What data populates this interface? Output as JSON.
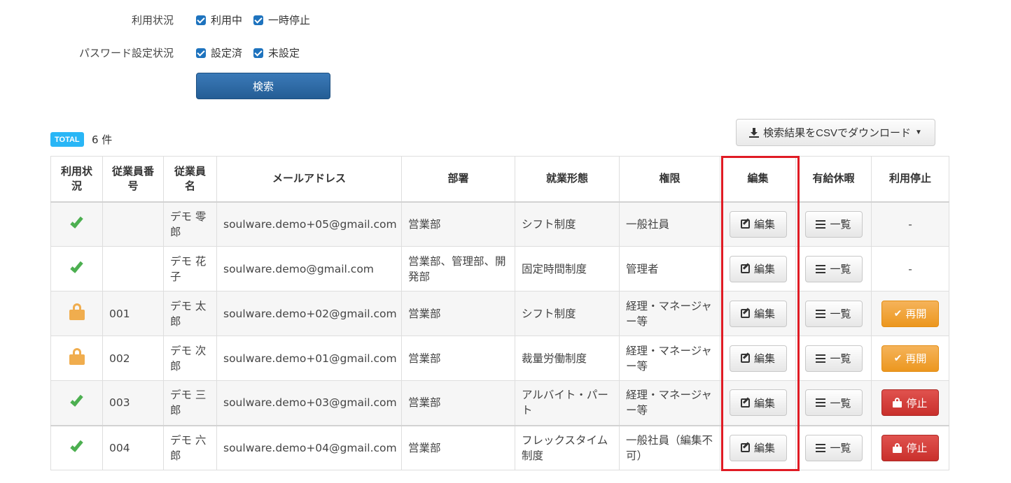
{
  "filters": {
    "usage": {
      "label": "利用状況",
      "options": [
        "利用中",
        "一時停止"
      ]
    },
    "password": {
      "label": "パスワード設定状況",
      "options": [
        "設定済",
        "未設定"
      ]
    },
    "search_label": "検索"
  },
  "summary": {
    "badge": "TOTAL",
    "count": "6 件"
  },
  "csv_button": {
    "label": "検索結果をCSVでダウンロード"
  },
  "table": {
    "headers": {
      "status": "利用状況",
      "employee_no": "従業員番号",
      "employee_name": "従業員名",
      "email": "メールアドレス",
      "department": "部署",
      "work_type": "就業形態",
      "permission": "権限",
      "edit": "編集",
      "leave": "有給休暇",
      "suspend": "利用停止"
    },
    "edit_label": "編集",
    "leave_label": "一覧",
    "rows": [
      {
        "status": "active",
        "no": "",
        "name": "デモ 零郎",
        "email": "soulware.demo+05@gmail.com",
        "dept": "営業部",
        "work": "シフト制度",
        "role": "一般社員",
        "suspend": "-"
      },
      {
        "status": "active",
        "no": "",
        "name": "デモ 花子",
        "email": "soulware.demo@gmail.com",
        "dept": "営業部、管理部、開発部",
        "work": "固定時間制度",
        "role": "管理者",
        "suspend": "-"
      },
      {
        "status": "locked",
        "no": "001",
        "name": "デモ 太郎",
        "email": "soulware.demo+02@gmail.com",
        "dept": "営業部",
        "work": "シフト制度",
        "role": "経理・マネージャー等",
        "suspend": "再開"
      },
      {
        "status": "locked",
        "no": "002",
        "name": "デモ 次郎",
        "email": "soulware.demo+01@gmail.com",
        "dept": "営業部",
        "work": "裁量労働制度",
        "role": "経理・マネージャー等",
        "suspend": "再開"
      },
      {
        "status": "active",
        "no": "003",
        "name": "デモ 三郎",
        "email": "soulware.demo+03@gmail.com",
        "dept": "営業部",
        "work": "アルバイト・パート",
        "role": "経理・マネージャー等",
        "suspend": "停止"
      },
      {
        "status": "active",
        "no": "004",
        "name": "デモ 六郎",
        "email": "soulware.demo+04@gmail.com",
        "dept": "営業部",
        "work": "フレックスタイム制度",
        "role": "一般社員（編集不可）",
        "suspend": "停止"
      }
    ]
  },
  "colors": {
    "primary": "#245d95",
    "warning": "#ec971f",
    "danger": "#c9302c",
    "success": "#4caf50",
    "highlight": "#e01b24",
    "badge": "#29b6f6"
  }
}
